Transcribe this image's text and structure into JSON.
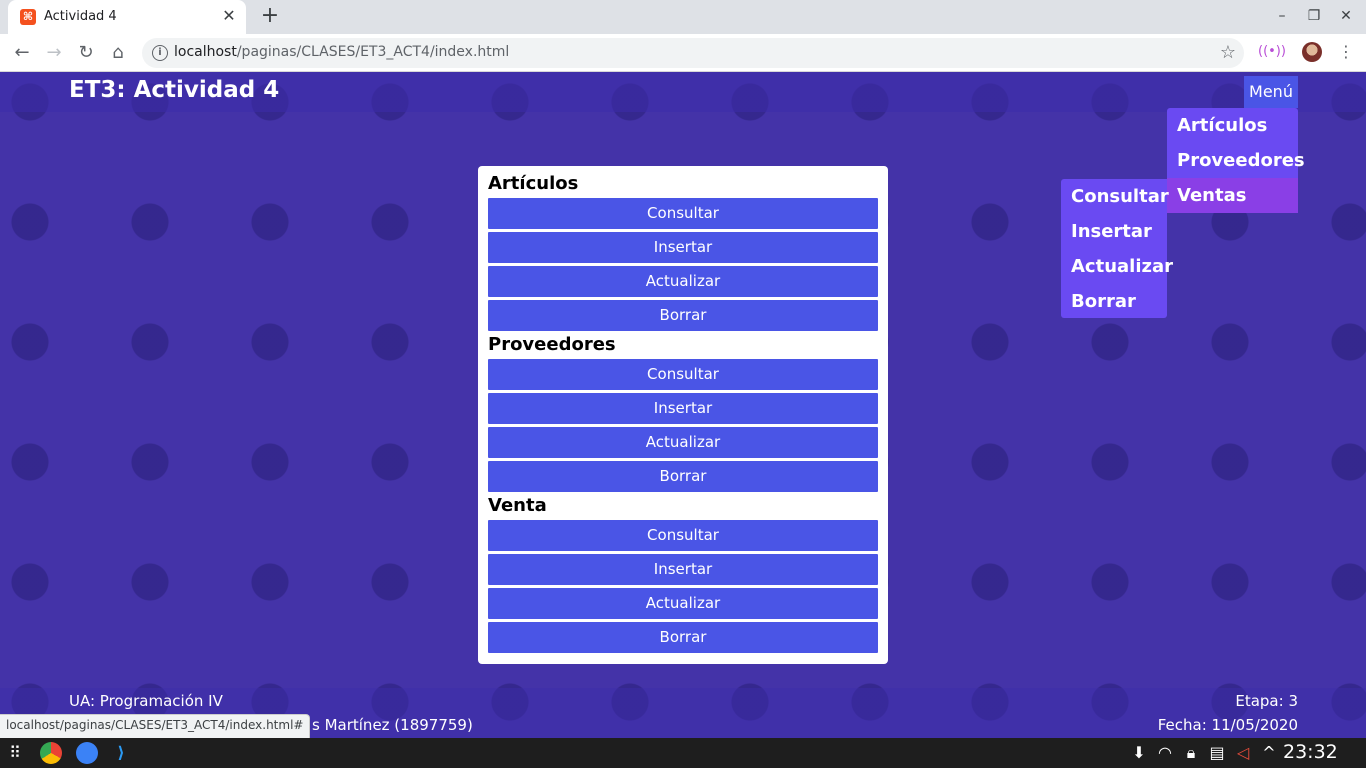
{
  "browser": {
    "tab_title": "Actividad 4",
    "url_host": "localhost",
    "url_path": "/paginas/CLASES/ET3_ACT4/index.html",
    "status_url": "localhost/paginas/CLASES/ET3_ACT4/index.html#"
  },
  "header": {
    "title": "ET3: Actividad 4",
    "menu_label": "Menú"
  },
  "dropdown": {
    "items": [
      {
        "label": "Artículos"
      },
      {
        "label": "Proveedores"
      },
      {
        "label": "Ventas"
      }
    ]
  },
  "submenu": {
    "items": [
      {
        "label": "Consultar"
      },
      {
        "label": "Insertar"
      },
      {
        "label": "Actualizar"
      },
      {
        "label": "Borrar"
      }
    ]
  },
  "sections": [
    {
      "title": "Artículos",
      "buttons": [
        "Consultar",
        "Insertar",
        "Actualizar",
        "Borrar"
      ]
    },
    {
      "title": "Proveedores",
      "buttons": [
        "Consultar",
        "Insertar",
        "Actualizar",
        "Borrar"
      ]
    },
    {
      "title": "Venta",
      "buttons": [
        "Consultar",
        "Insertar",
        "Actualizar",
        "Borrar"
      ]
    }
  ],
  "footer": {
    "ua": "UA: Programación IV",
    "student_partial": "s Martínez (1897759)",
    "etapa": "Etapa: 3",
    "fecha": "Fecha: 11/05/2020"
  },
  "taskbar": {
    "clock": "23:32"
  },
  "colors": {
    "primary_button": "#4a55e6",
    "menu_bg": "#6a4af2",
    "active_item": "#8a3fe6"
  }
}
